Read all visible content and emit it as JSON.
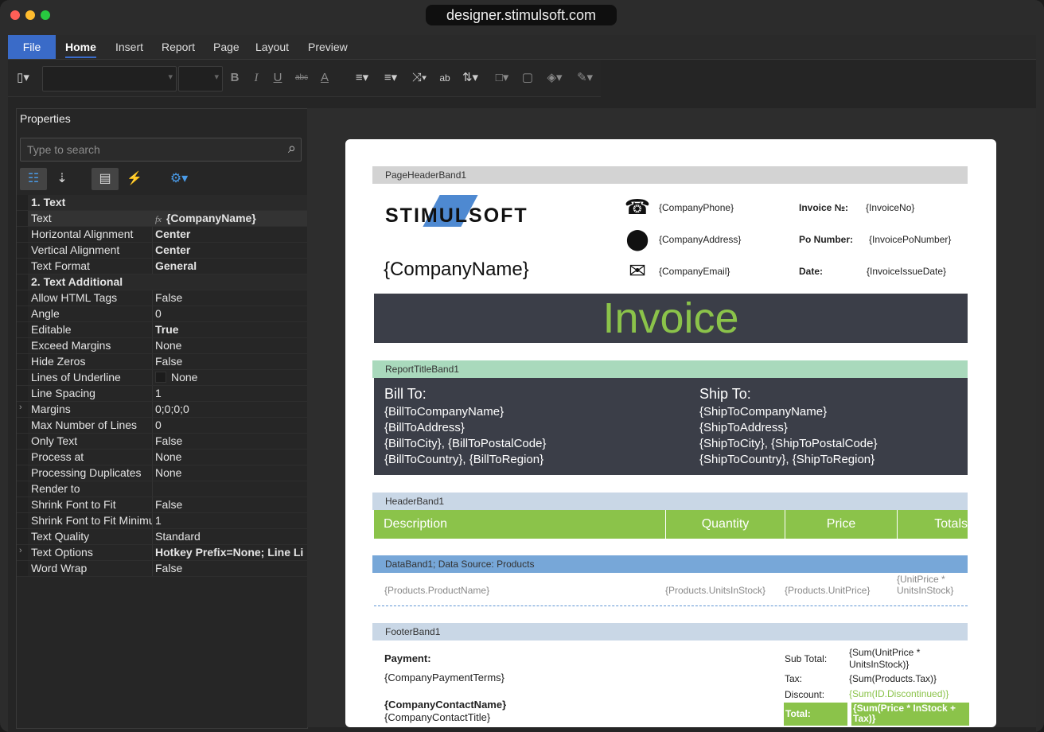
{
  "window": {
    "url": "designer.stimulsoft.com",
    "traffic_lights": [
      "#ff5f57",
      "#febc2e",
      "#28c840"
    ]
  },
  "menu": {
    "file": "File",
    "tabs": [
      "Home",
      "Insert",
      "Report",
      "Page",
      "Layout",
      "Preview"
    ]
  },
  "toolbar": {
    "paste_icon": "paste-icon",
    "bold": "B",
    "italic": "I",
    "underline": "U",
    "strike": "abc",
    "font_color": "A"
  },
  "properties": {
    "title": "Properties",
    "search_placeholder": "Type to search",
    "categories": [
      {
        "label": "1. Text",
        "rows": [
          {
            "name": "Text",
            "value": "{CompanyName}",
            "fx": "fx",
            "bold": true
          },
          {
            "name": "Horizontal Alignment",
            "value": "Center",
            "bold": true
          },
          {
            "name": "Vertical Alignment",
            "value": "Center",
            "bold": true
          },
          {
            "name": "Text Format",
            "value": "General",
            "bold": true
          }
        ]
      },
      {
        "label": "2. Text  Additional",
        "rows": [
          {
            "name": "Allow HTML Tags",
            "value": "False"
          },
          {
            "name": "Angle",
            "value": "0"
          },
          {
            "name": "Editable",
            "value": "True",
            "bold": true
          },
          {
            "name": "Exceed Margins",
            "value": "None"
          },
          {
            "name": "Hide Zeros",
            "value": "False"
          },
          {
            "name": "Lines of Underline",
            "value": "None",
            "checkbox": true
          },
          {
            "name": "Line Spacing",
            "value": "1"
          },
          {
            "name": "Margins",
            "value": "0;0;0;0",
            "expand": "›"
          },
          {
            "name": "Max Number of Lines",
            "value": "0"
          },
          {
            "name": "Only Text",
            "value": "False"
          },
          {
            "name": "Process at",
            "value": "None"
          },
          {
            "name": "Processing Duplicates",
            "value": "None"
          },
          {
            "name": "Render to",
            "value": ""
          },
          {
            "name": "Shrink Font to Fit",
            "value": "False"
          },
          {
            "name": "Shrink Font to Fit Minimum",
            "value": "1"
          },
          {
            "name": "Text Quality",
            "value": "Standard"
          },
          {
            "name": "Text Options",
            "value": "Hotkey Prefix=None; Line Li",
            "bold": true,
            "expand": "›"
          },
          {
            "name": "Word Wrap",
            "value": "False"
          }
        ]
      }
    ]
  },
  "report": {
    "page_header_band": "PageHeaderBand1",
    "logo": "STIMULSOFT",
    "company_name": "{CompanyName}",
    "company_phone": "{CompanyPhone}",
    "company_address": "{CompanyAddress}",
    "company_email": "{CompanyEmail}",
    "invoice_no_label": "Invoice №:",
    "invoice_no": "{InvoiceNo}",
    "po_label": "Po Number:",
    "po_value": "{InvoicePoNumber}",
    "date_label": "Date:",
    "date_value": "{InvoiceIssueDate}",
    "invoice_title": "Invoice",
    "report_title_band": "ReportTitleBand1",
    "bill_to": "Bill To:",
    "bill_lines": [
      "{BillToCompanyName}",
      "{BillToAddress}",
      "{BillToCity}, {BillToPostalCode}",
      "{BillToCountry}, {BillToRegion}"
    ],
    "ship_to": "Ship To:",
    "ship_lines": [
      "{ShipToCompanyName}",
      "{ShipToAddress}",
      "{ShipToCity}, {ShipToPostalCode}",
      "{ShipToCountry}, {ShipToRegion}"
    ],
    "header_band": "HeaderBand1",
    "columns": [
      "Description",
      "Quantity",
      "Price",
      "Totals"
    ],
    "data_band": "DataBand1; Data Source: Products",
    "data_cells": [
      "{Products.ProductName}",
      "{Products.UnitsInStock}",
      "{Products.UnitPrice}",
      "{UnitPrice * UnitsInStock}"
    ],
    "footer_band": "FooterBand1",
    "payment_label": "Payment:",
    "payment_terms": "{CompanyPaymentTerms}",
    "contact_name": "{CompanyContactName}",
    "contact_title": "{CompanyContactTitle}",
    "subtotal_label": "Sub Total:",
    "subtotal_value": "{Sum(UnitPrice * UnitsInStock)}",
    "tax_label": "Tax:",
    "tax_value": "{Sum(Products.Tax)}",
    "discount_label": "Discount:",
    "discount_value": "{Sum(ID.Discontinued)}",
    "total_label": "Total:",
    "total_value": "{Sum(Price * InStock + Tax)}"
  },
  "colors": {
    "accent": "#3a6bc8",
    "green": "#8bc34a",
    "dark_band": "#3b3e48"
  }
}
